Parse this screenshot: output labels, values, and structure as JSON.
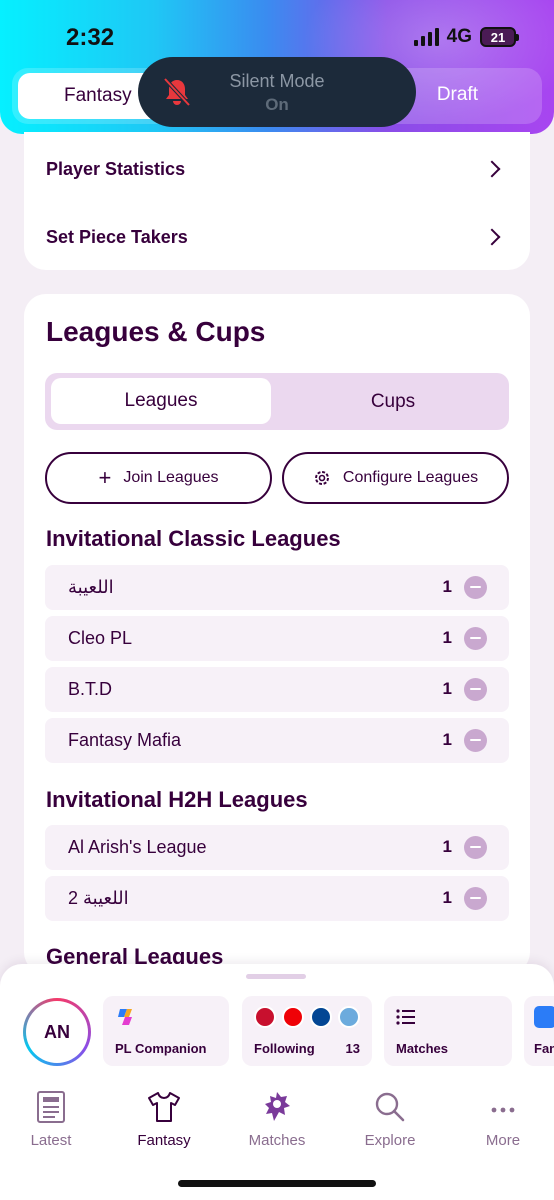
{
  "status_bar": {
    "time": "2:32",
    "network": "4G",
    "battery": "21"
  },
  "top_segment": {
    "left_label": "Fantasy",
    "right_label": "Draft"
  },
  "silent_banner": {
    "title": "Silent Mode",
    "state": "On"
  },
  "menu": [
    {
      "label": "Player Statistics"
    },
    {
      "label": "Set Piece Takers"
    }
  ],
  "leagues": {
    "title": "Leagues & Cups",
    "tabs": [
      {
        "label": "Leagues"
      },
      {
        "label": "Cups"
      }
    ],
    "join_label": "Join Leagues",
    "configure_label": "Configure Leagues",
    "sections": [
      {
        "title": "Invitational Classic Leagues",
        "rows": [
          {
            "name": "اللعيبة",
            "count": "1"
          },
          {
            "name": "Cleo PL",
            "count": "1"
          },
          {
            "name": "B.T.D",
            "count": "1"
          },
          {
            "name": "Fantasy Mafia",
            "count": "1"
          }
        ]
      },
      {
        "title": "Invitational H2H Leagues",
        "rows": [
          {
            "name": "Al Arish's League",
            "count": "1"
          },
          {
            "name": "اللعيبة 2",
            "count": "1"
          }
        ]
      },
      {
        "title": "General Leagues",
        "rows": []
      }
    ]
  },
  "companion": {
    "avatar_initials": "AN",
    "tiles": [
      {
        "label": "PL Companion"
      },
      {
        "label": "Following",
        "count": "13"
      },
      {
        "label": "Matches"
      },
      {
        "label": "Fan"
      }
    ]
  },
  "nav": [
    {
      "label": "Latest",
      "icon": "newspaper-icon"
    },
    {
      "label": "Fantasy",
      "icon": "shirt-icon"
    },
    {
      "label": "Matches",
      "icon": "lion-icon"
    },
    {
      "label": "Explore",
      "icon": "search-icon"
    },
    {
      "label": "More",
      "icon": "more-icon"
    }
  ],
  "colors": {
    "brand": "#37003c",
    "accent_light": "#ebd8ef",
    "minus": "#c9a8cf"
  }
}
